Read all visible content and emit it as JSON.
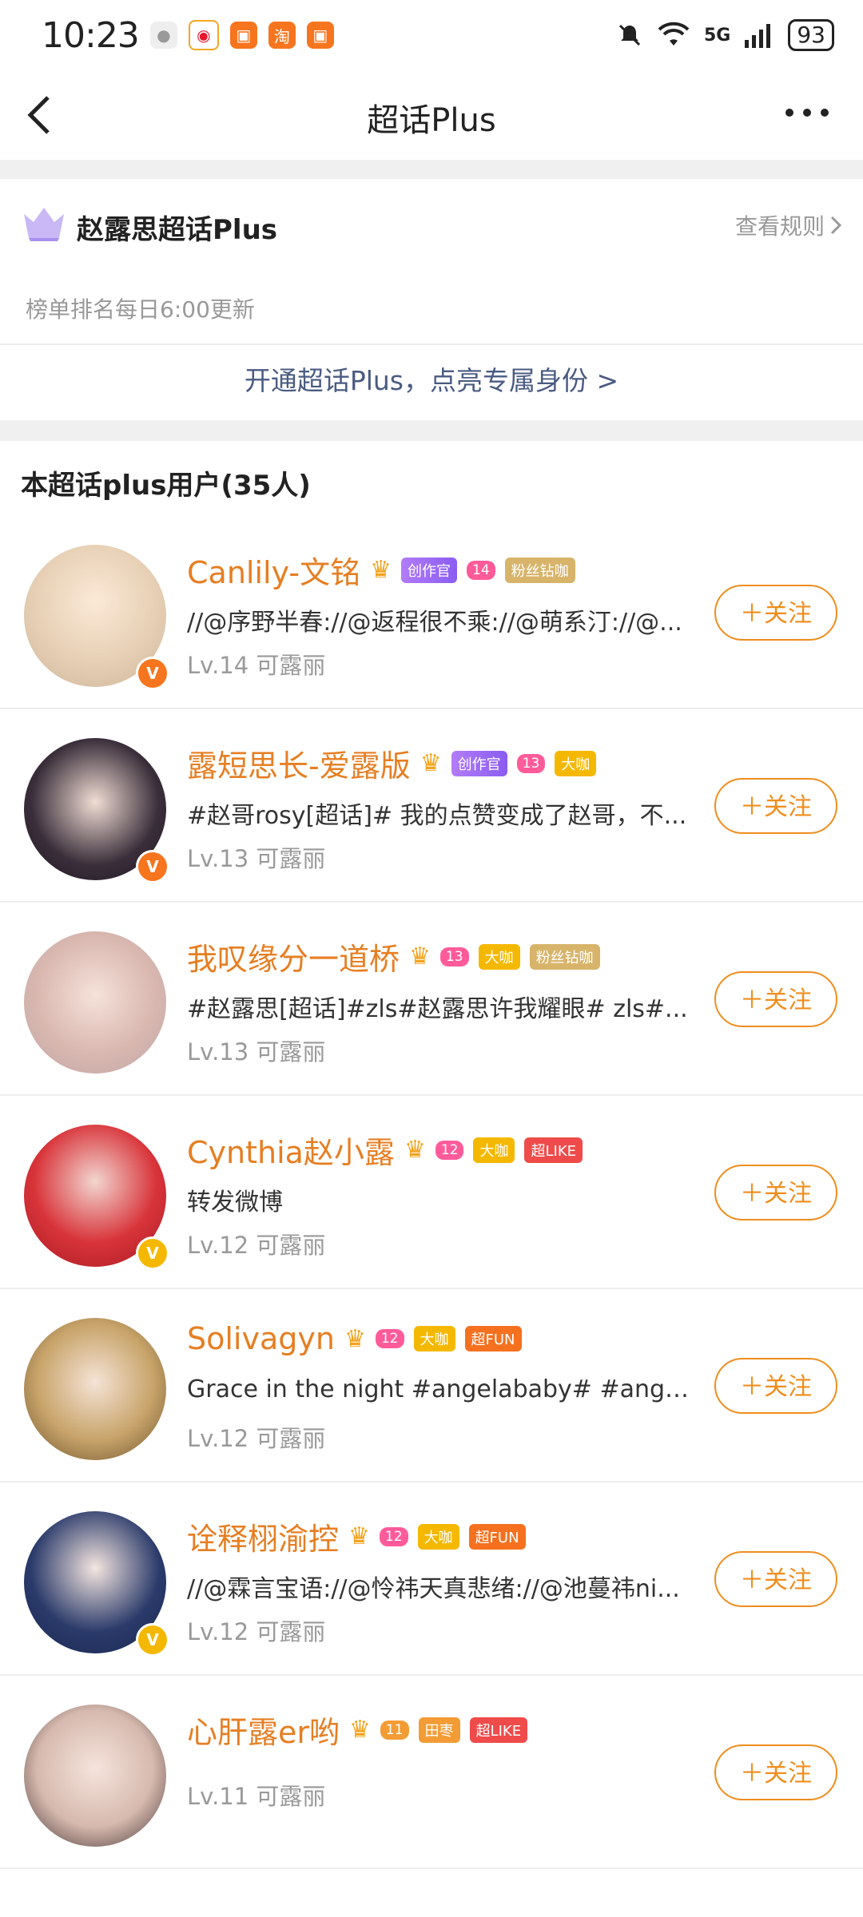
{
  "status": {
    "time": "10:23",
    "battery": "93",
    "net": "5G"
  },
  "nav": {
    "title": "超话Plus"
  },
  "plus": {
    "title": "赵露思超话Plus",
    "rules_label": "查看规则",
    "rank_note": "榜单排名每日6:00更新",
    "cta": "开通超话Plus，点亮专属身份 >"
  },
  "section": {
    "title": "本超话plus用户(35人)"
  },
  "users": [
    {
      "name": "Canlily-文铭",
      "desc": "//@序野半春://@返程很不乘://@萌系汀://@...",
      "meta": "Lv.14 可露丽",
      "follow": "＋关注",
      "lvl": "14",
      "tags": [
        "创作官",
        "粉丝钻咖"
      ],
      "v": "orange"
    },
    {
      "name": "露短思长-爱露版",
      "desc": "#赵哥rosy[超话]#  我的点赞变成了赵哥，不...",
      "meta": "Lv.13 可露丽",
      "follow": "＋关注",
      "lvl": "13",
      "tags": [
        "创作官",
        "大咖"
      ],
      "v": "orange"
    },
    {
      "name": "我叹缘分一道桥",
      "desc": "#赵露思[超话]#zls#赵露思许我耀眼# zls#...",
      "meta": "Lv.13 可露丽",
      "follow": "＋关注",
      "lvl": "13",
      "tags": [
        "大咖",
        "粉丝钻咖"
      ],
      "v": ""
    },
    {
      "name": "Cynthia赵小露",
      "desc": "转发微博",
      "meta": "Lv.12 可露丽",
      "follow": "＋关注",
      "lvl": "12",
      "tags": [
        "大咖",
        "超LIKE"
      ],
      "v": "yellow"
    },
    {
      "name": "Solivagyn",
      "desc": "Grace in the night  #angelababy# #angela...",
      "meta": "Lv.12 可露丽",
      "follow": "＋关注",
      "lvl": "12",
      "tags": [
        "大咖",
        "超FUN"
      ],
      "v": ""
    },
    {
      "name": "诠释栩渝控",
      "desc": "//@霖言宝语://@怜祎天真悲绪://@池蔓祎ni...",
      "meta": "Lv.12 可露丽",
      "follow": "＋关注",
      "lvl": "12",
      "tags": [
        "大咖",
        "超FUN"
      ],
      "v": "yellow"
    },
    {
      "name": "心肝露er哟",
      "desc": "",
      "meta": "Lv.11 可露丽",
      "follow": "＋关注",
      "lvl": "11",
      "tags": [
        "田枣",
        "超LIKE"
      ],
      "v": ""
    }
  ],
  "colors": {
    "accent": "#e67e22",
    "follow": "#ef8d1d",
    "link": "#4a5b82",
    "bg_gap": "#f0f0f0"
  }
}
